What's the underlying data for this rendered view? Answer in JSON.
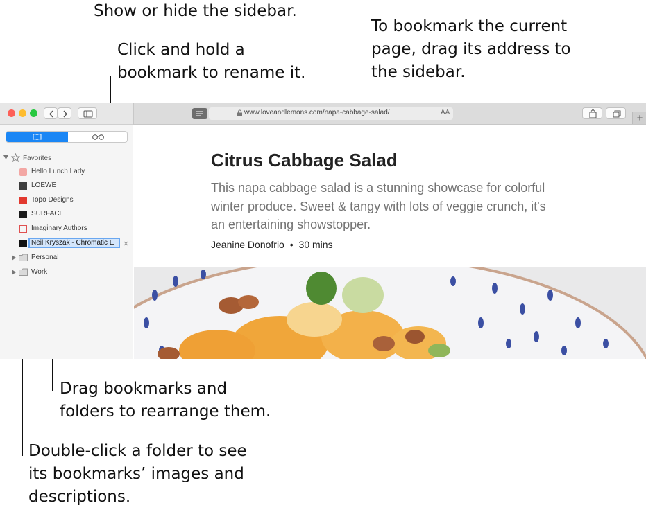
{
  "callouts": {
    "sidebar_toggle": "Show or hide the sidebar.",
    "rename_line1": "Click and hold a",
    "rename_line2": "bookmark to rename it.",
    "bookmark_line1": "To bookmark the current",
    "bookmark_line2": "page, drag its address to",
    "bookmark_line3": "the sidebar.",
    "drag_line1": "Drag bookmarks and",
    "drag_line2": "folders to rearrange them.",
    "dblclick_line1": "Double-click a folder to see",
    "dblclick_line2": "its bookmarks’ images and",
    "dblclick_line3": "descriptions."
  },
  "toolbar": {
    "url": "www.loveandlemons.com/napa-cabbage-salad/",
    "text_size_label": "AA",
    "new_tab_label": "+",
    "colors": {
      "accent": "#1a86f5",
      "close": "#fd5f57",
      "minimize": "#febc2e",
      "zoom": "#28c840"
    }
  },
  "sidebar": {
    "tabs": [
      {
        "icon": "book-icon",
        "selected": true
      },
      {
        "icon": "reading-glasses-icon",
        "selected": false
      }
    ],
    "favorites_label": "Favorites",
    "bookmarks": [
      {
        "label": "Hello Lunch Lady",
        "icon": "hello-lunch-lady-favicon"
      },
      {
        "label": "LOEWE",
        "icon": "loewe-favicon"
      },
      {
        "label": "Topo Designs",
        "icon": "topo-designs-favicon"
      },
      {
        "label": "SURFACE",
        "icon": "surface-favicon"
      },
      {
        "label": "Imaginary Authors",
        "icon": "imaginary-authors-favicon"
      }
    ],
    "renaming_value": "Neil Kryszak - Chromatic E",
    "folders": [
      {
        "label": "Personal",
        "icon": "folder-icon"
      },
      {
        "label": "Work",
        "icon": "folder-icon"
      }
    ]
  },
  "article": {
    "title": "Citrus Cabbage Salad",
    "description": "This napa cabbage salad is a stunning showcase for colorful winter produce. Sweet & tangy with lots of veggie crunch, it's an entertaining showstopper.",
    "author": "Jeanine Donofrio",
    "separator": "•",
    "time": "30 mins"
  }
}
